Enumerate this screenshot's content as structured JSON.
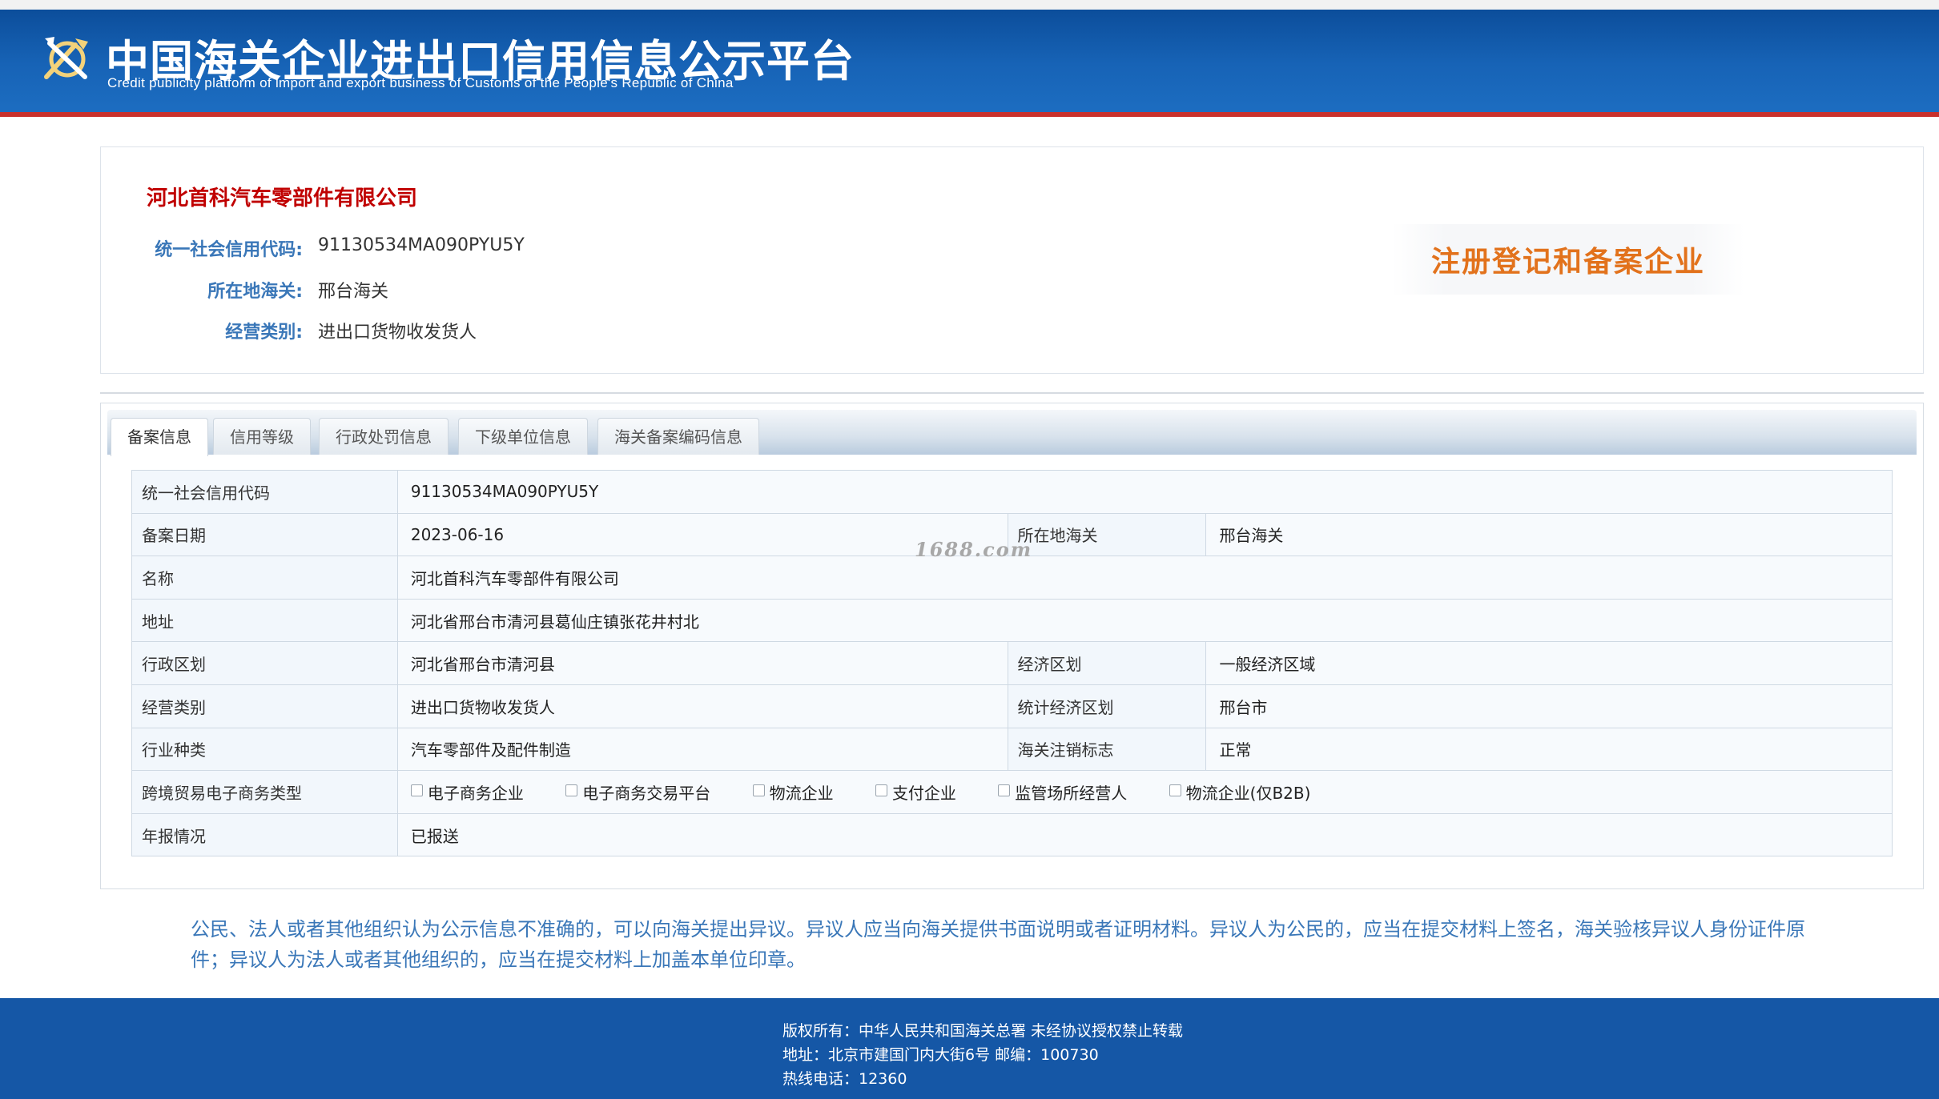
{
  "header": {
    "title": "中国海关企业进出口信用信息公示平台",
    "subtitle": "Credit publicity platform of import and export business of Customs of the People's Republic of China",
    "logo_icon": "customs-emblem-icon"
  },
  "company": {
    "name": "河北首科汽车零部件有限公司",
    "rows": [
      {
        "label": "统一社会信用代码:",
        "value": "91130534MA090PYU5Y"
      },
      {
        "label": "所在地海关:",
        "value": "邢台海关"
      },
      {
        "label": "经营类别:",
        "value": "进出口货物收发货人"
      }
    ],
    "badge": "注册登记和备案企业"
  },
  "tabs": [
    {
      "label": "备案信息",
      "active": true
    },
    {
      "label": "信用等级",
      "active": false
    },
    {
      "label": "行政处罚信息",
      "active": false
    },
    {
      "label": "下级单位信息",
      "active": false
    },
    {
      "label": "海关备案编码信息",
      "active": false
    }
  ],
  "detail": {
    "credit_code_label": "统一社会信用代码",
    "credit_code": "91130534MA090PYU5Y",
    "record_date_label": "备案日期",
    "record_date": "2023-06-16",
    "customs_label": "所在地海关",
    "customs": "邢台海关",
    "name_label": "名称",
    "name": "河北首科汽车零部件有限公司",
    "address_label": "地址",
    "address": "河北省邢台市清河县葛仙庄镇张花井村北",
    "admin_region_label": "行政区划",
    "admin_region": "河北省邢台市清河县",
    "econ_region_label": "经济区划",
    "econ_region": "一般经济区域",
    "business_type_label": "经营类别",
    "business_type": "进出口货物收发货人",
    "stat_region_label": "统计经济区划",
    "stat_region": "邢台市",
    "industry_label": "行业种类",
    "industry": "汽车零部件及配件制造",
    "cancel_flag_label": "海关注销标志",
    "cancel_flag": "正常",
    "ecommerce_label": "跨境贸易电子商务类型",
    "ecommerce_options": [
      {
        "label": "电子商务企业",
        "checked": false
      },
      {
        "label": "电子商务交易平台",
        "checked": false
      },
      {
        "label": "物流企业",
        "checked": false
      },
      {
        "label": "支付企业",
        "checked": false
      },
      {
        "label": "监管场所经营人",
        "checked": false
      },
      {
        "label": "物流企业(仅B2B)",
        "checked": false
      }
    ],
    "annual_report_label": "年报情况",
    "annual_report": "已报送"
  },
  "watermark": "1688.com",
  "notice": "公民、法人或者其他组织认为公示信息不准确的，可以向海关提出异议。异议人应当向海关提供书面说明或者证明材料。异议人为公民的，应当在提交材料上签名，海关验核异议人身份证件原件；异议人为法人或者其他组织的，应当在提交材料上加盖本单位印章。",
  "footer": {
    "copyright": "版权所有：中华人民共和国海关总署   未经协议授权禁止转载",
    "address": "地址：北京市建国门内大街6号 邮编：100730",
    "hotline": "热线电话：12360"
  },
  "colors": {
    "header_blue": "#1763b6",
    "footer_blue": "#1557a6",
    "company_red": "#c00000",
    "label_blue": "#3a77b8",
    "badge_orange": "#e2721c"
  }
}
